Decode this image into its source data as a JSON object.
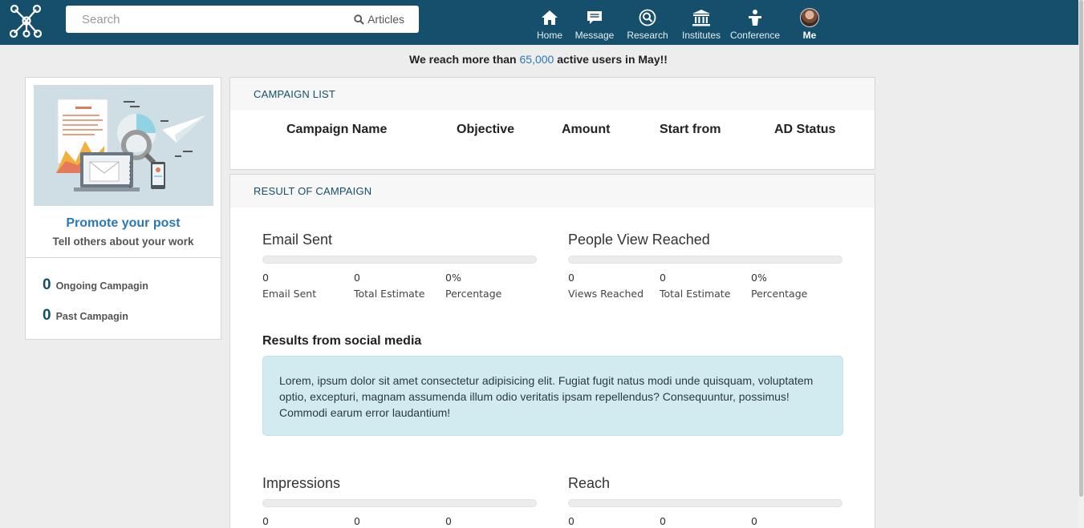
{
  "header": {
    "search_placeholder": "Search",
    "search_button": "Articles",
    "nav": [
      {
        "label": "Home",
        "icon": "home-icon"
      },
      {
        "label": "Message",
        "icon": "message-icon"
      },
      {
        "label": "Research",
        "icon": "research-icon"
      },
      {
        "label": "Institutes",
        "icon": "institutes-icon"
      },
      {
        "label": "Conference",
        "icon": "conference-icon"
      },
      {
        "label": "Me",
        "icon": "avatar"
      }
    ]
  },
  "announcement": {
    "prefix": "We reach more than",
    "highlight": "65,000",
    "suffix": "active users in May!!"
  },
  "sidebar": {
    "promo_title": "Promote your post",
    "promo_subtitle": "Tell others about your work",
    "ongoing_count": "0",
    "ongoing_label": "Ongoing Campagin",
    "past_count": "0",
    "past_label": "Past Campagin"
  },
  "campaign_list": {
    "heading": "CAMPAIGN LIST",
    "columns": [
      "Campaign Name",
      "Objective",
      "Amount",
      "Start from",
      "AD Status"
    ]
  },
  "results": {
    "heading": "RESULT OF CAMPAIGN",
    "email": {
      "title": "Email Sent",
      "progress": 0,
      "values": [
        "0",
        "0",
        "0%"
      ],
      "labels": [
        "Email Sent",
        "Total Estimate",
        "Percentage"
      ]
    },
    "views": {
      "title": "People View Reached",
      "progress": 0,
      "values": [
        "0",
        "0",
        "0%"
      ],
      "labels": [
        "Views Reached",
        "Total Estimate",
        "Percentage"
      ]
    },
    "social_title": "Results from social media",
    "social_text": "Lorem, ipsum dolor sit amet consectetur adipisicing elit. Fugiat fugit natus modi unde quisquam, voluptatem optio, excepturi, magnam assumenda illum odio veritatis ipsam repellendus? Consequuntur, possimus! Commodi earum error laudantium!",
    "impressions": {
      "title": "Impressions",
      "progress": 0,
      "values": [
        "0",
        "0",
        "0"
      ]
    },
    "reach": {
      "title": "Reach",
      "progress": 0,
      "values": [
        "0",
        "0",
        "0"
      ]
    }
  },
  "colors": {
    "nav_bg": "#154f6b",
    "accent": "#2a78b8",
    "alert_bg": "#d1ebf0"
  }
}
